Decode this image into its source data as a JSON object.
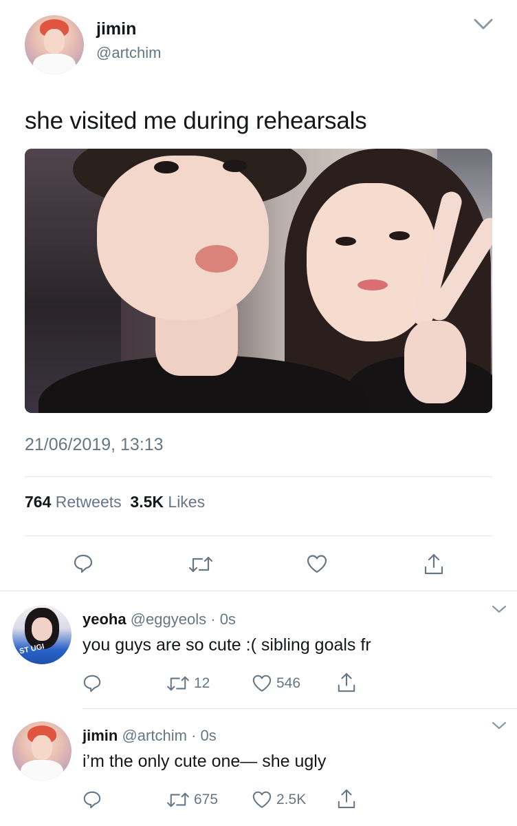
{
  "tweet": {
    "author": {
      "name": "jimin",
      "handle": "@artchim"
    },
    "text": "she visited me during rehearsals",
    "timestamp": "21/06/2019, 13:13",
    "stats": {
      "retweets_count": "764",
      "retweets_label": "Retweets",
      "likes_count": "3.5K",
      "likes_label": "Likes"
    }
  },
  "replies": [
    {
      "name": "yeoha",
      "handle": "@eggyeols",
      "time": "· 0s",
      "text": "you guys are so cute :( sibling goals fr",
      "retweets": "12",
      "likes": "546",
      "avatar_text": "ST UGI"
    },
    {
      "name": "jimin",
      "handle": "@artchim",
      "time": "· 0s",
      "text": "i’m the only cute one— she ugly",
      "retweets": "675",
      "likes": "2.5K"
    }
  ],
  "icons": {
    "reply": "comment-bubble-icon",
    "retweet": "retweet-icon",
    "like": "heart-outline-icon",
    "share": "share-upload-icon",
    "more": "chevron-down-icon"
  },
  "colors": {
    "text": "#14171a",
    "secondary": "#657786",
    "divider": "#e1e8ed"
  }
}
